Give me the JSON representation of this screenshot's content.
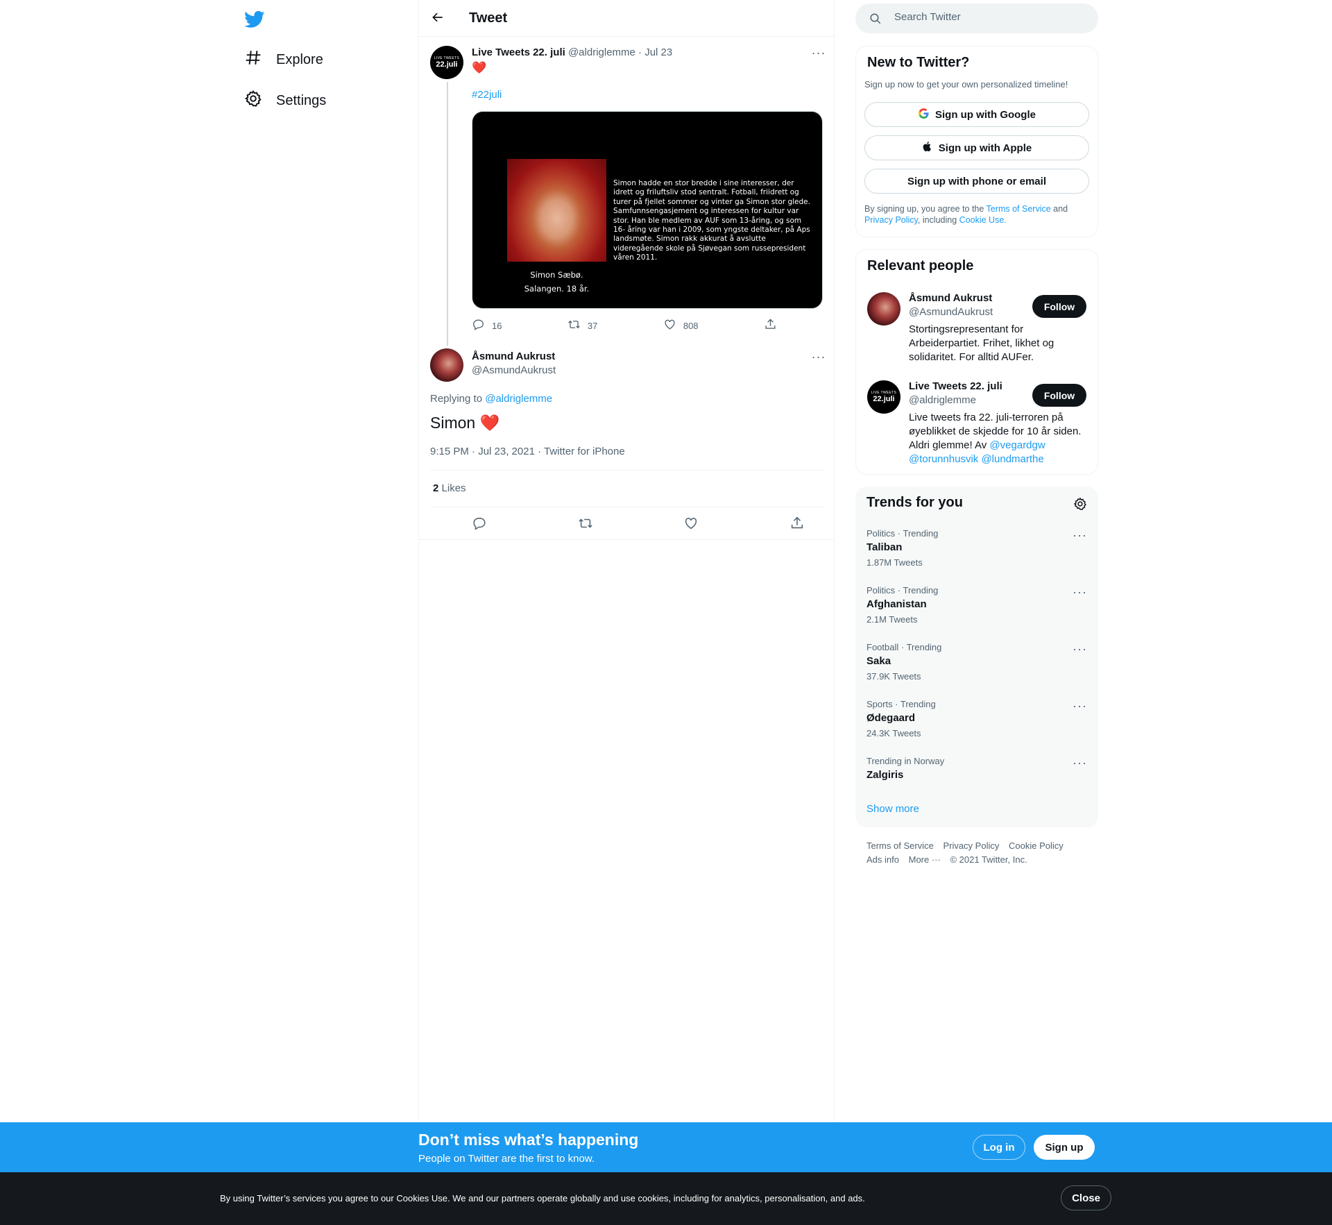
{
  "nav": {
    "logo_icon": "twitter-bird-icon",
    "items": [
      {
        "label": "Explore",
        "icon": "hashtag-icon"
      },
      {
        "label": "Settings",
        "icon": "gear-icon"
      }
    ]
  },
  "header": {
    "title": "Tweet"
  },
  "parent_tweet": {
    "avatar_small": "LIVE TWEETS",
    "avatar_big": "22.juli",
    "name": "Live Tweets 22. juli",
    "handle": "@aldriglemme",
    "sep": "·",
    "date": "Jul 23",
    "emoji": "❤️",
    "hashtag": "#22juli",
    "media_text": "Simon hadde en stor bredde i sine interesser, der idrett og friluftsliv stod sentralt. Fotball, friidrett og turer på fjellet sommer og vinter ga Simon stor glede. Samfunnsengasjement og interessen for kultur var stor. Han ble medlem av AUF som 13-åring, og som 16- åring var han i 2009, som yngste deltaker, på Aps landsmøte. Simon rakk akkurat å avslutte videregående skole på Sjøvegan som russepresident våren 2011.",
    "media_caption_1": "Simon Sæbø.",
    "media_caption_2": "Salangen. 18 år.",
    "replies": "16",
    "retweets": "37",
    "likes": "808"
  },
  "main_tweet": {
    "name": "Åsmund Aukrust",
    "handle": "@AsmundAukrust",
    "replying_prefix": "Replying to",
    "replying_handle": "@aldriglemme",
    "text": "Simon",
    "emoji": "❤️",
    "timestamp": "9:15 PM · Jul 23, 2021 · Twitter for iPhone",
    "likes_count": "2",
    "likes_label": "Likes"
  },
  "search": {
    "placeholder": "Search Twitter"
  },
  "signup_card": {
    "title": "New to Twitter?",
    "subtitle": "Sign up now to get your own personalized timeline!",
    "google": "Sign up with Google",
    "apple": "Sign up with Apple",
    "email": "Sign up with phone or email",
    "terms_1": "By signing up, you agree to the",
    "terms_link": "Terms of Service",
    "terms_2": "and",
    "privacy_link": "Privacy Policy",
    "terms_3": ", including",
    "cookie_link": "Cookie Use."
  },
  "people_card": {
    "title": "Relevant people",
    "people": [
      {
        "name": "Åsmund Aukrust",
        "handle": "@AsmundAukrust",
        "bio": "Stortingsrepresentant for Arbeiderpartiet. Frihet, likhet og solidaritet. For alltid AUFer.",
        "follow": "Follow"
      },
      {
        "name": "Live Tweets 22. juli",
        "handle": "@aldriglemme",
        "bio": "Live tweets fra 22. juli-terroren på øyeblikket de skjedde for 10 år siden. Aldri glemme! Av",
        "bio_links": [
          "@vegardgw",
          "@torunnhusvik",
          "@lundmarthe"
        ],
        "follow": "Follow"
      }
    ]
  },
  "trends_card": {
    "title": "Trends for you",
    "trends": [
      {
        "meta": "Politics · Trending",
        "name": "Taliban",
        "count": "1.87M Tweets"
      },
      {
        "meta": "Politics · Trending",
        "name": "Afghanistan",
        "count": "2.1M Tweets"
      },
      {
        "meta": "Football · Trending",
        "name": "Saka",
        "count": "37.9K Tweets"
      },
      {
        "meta": "Sports · Trending",
        "name": "Ødegaard",
        "count": "24.3K Tweets"
      },
      {
        "meta": "Trending in Norway",
        "name": "Zalgiris",
        "count": ""
      }
    ],
    "show_more": "Show more"
  },
  "footer": {
    "links": [
      "Terms of Service",
      "Privacy Policy",
      "Cookie Policy",
      "Ads info",
      "More ···",
      "© 2021 Twitter, Inc."
    ]
  },
  "banner": {
    "title": "Don’t miss what’s happening",
    "subtitle": "People on Twitter are the first to know.",
    "login": "Log in",
    "signup": "Sign up"
  },
  "cookie": {
    "text": "By using Twitter’s services you agree to our Cookies Use. We and our partners operate globally and use cookies, including for analytics, personalisation, and ads.",
    "close": "Close"
  },
  "colors": {
    "accent": "#1d9bf0",
    "text": "#0f1419",
    "muted": "#536471",
    "heart": "#f91880",
    "cookie_bg": "#15181c"
  }
}
